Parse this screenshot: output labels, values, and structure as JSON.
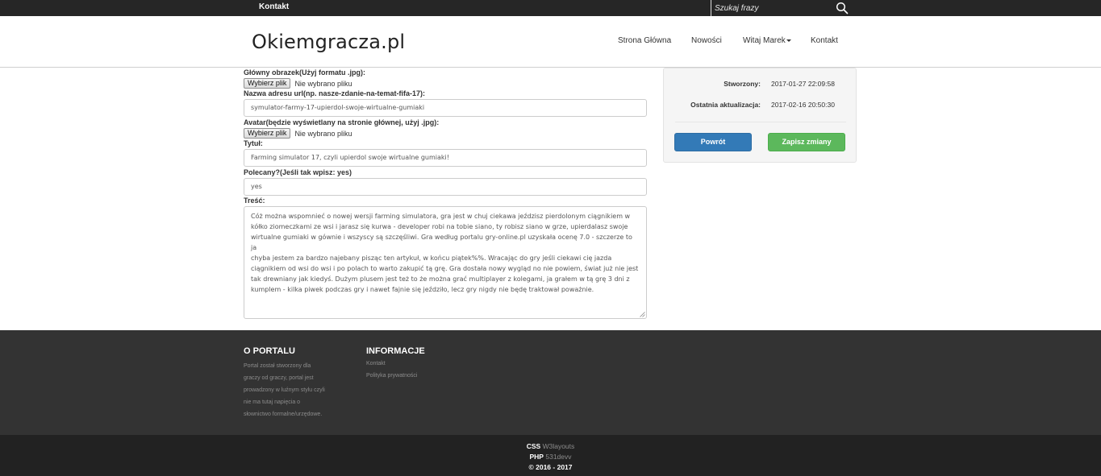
{
  "topbar": {
    "contact_label": "Kontakt",
    "search_placeholder": "Szukaj frazy"
  },
  "header": {
    "logo": "Okiemgracza.pl",
    "nav": {
      "home": "Strona Główna",
      "news": "Nowości",
      "user": "Witaj Marek",
      "contact": "Kontakt"
    }
  },
  "form": {
    "main_image": {
      "label": "Główny obrazek(Użyj formatu .jpg):",
      "button": "Wybierz plik",
      "status": "Nie wybrano pliku"
    },
    "url": {
      "label": "Nazwa adresu url(np. nasze-zdanie-na-temat-fifa-17):",
      "value": "symulator-farmy-17-upierdol-swoje-wirtualne-gumiaki"
    },
    "avatar": {
      "label": "Avatar(będzie wyświetlany na stronie głównej, użyj .jpg):",
      "button": "Wybierz plik",
      "status": "Nie wybrano pliku"
    },
    "title": {
      "label": "Tytuł:",
      "value": "Farming simulator 17, czyli upierdol swoje wirtualne gumiaki!"
    },
    "recommended": {
      "label": "Polecany?(Jeśli tak wpisz: yes)",
      "value": "yes"
    },
    "content": {
      "label": "Treść:",
      "lines": [
        "Cóż można wspomnieć o nowej wersji farming simulatora, gra jest w chuj ciekawa jeździsz pierdolonym ciągnikiem w",
        "kółko ziomeczkami ze wsi i jarasz się kurwa - developer robi na tobie siano, ty robisz siano w grze, upierdalasz swoje",
        "wirtualne gumiaki w gównie i wszyscy są szczęśliwi. Gra według portalu gry-online.pl uzyskała ocenę 7.0 - szczerze to ja",
        "chyba jestem za bardzo najebany pisząc ten artykuł, w końcu piątek%%. Wracając do gry jeśli ciekawi cię jazda",
        "ciągnikiem od wsi do wsi i po polach to warto zakupić tą grę. Gra dostała nowy wygląd no nie powiem, świat już nie jest",
        "tak drewniany jak kiedyś. Dużym plusem jest też to że można grać multiplayer z kolegami, ja grałem w tą grę 3 dni z",
        "kumplem - kilka piwek podczas gry i nawet fajnie się jeździło, lecz gry nigdy nie będę traktował poważnie."
      ]
    }
  },
  "side": {
    "created_label": "Stworzony:",
    "created_value": "2017-01-27 22:09:58",
    "updated_label": "Ostatnia aktualizacja:",
    "updated_value": "2017-02-16 20:50:30",
    "back_button": "Powrót",
    "save_button": "Zapisz zmiany"
  },
  "footer": {
    "about_title": "O PORTALU",
    "about_lines": [
      "Portal został stworzony dla",
      "graczy od graczy, portal jest",
      "prowadzony w luźnym stylu czyli",
      "nie ma tutaj napięcia o",
      "słownictwo formalne/urzędowe."
    ],
    "info_title": "INFORMACJE",
    "info_links": [
      "Kontakt",
      "Polityka prywatności"
    ],
    "credits": {
      "css_label": "CSS",
      "css_value": "W3layouts",
      "php_label": "PHP",
      "php_value": "531devv",
      "copyright": "© 2016 - 2017"
    }
  },
  "icons": [
    "search-icon",
    "caret-down-icon",
    "resize-grip-icon"
  ]
}
